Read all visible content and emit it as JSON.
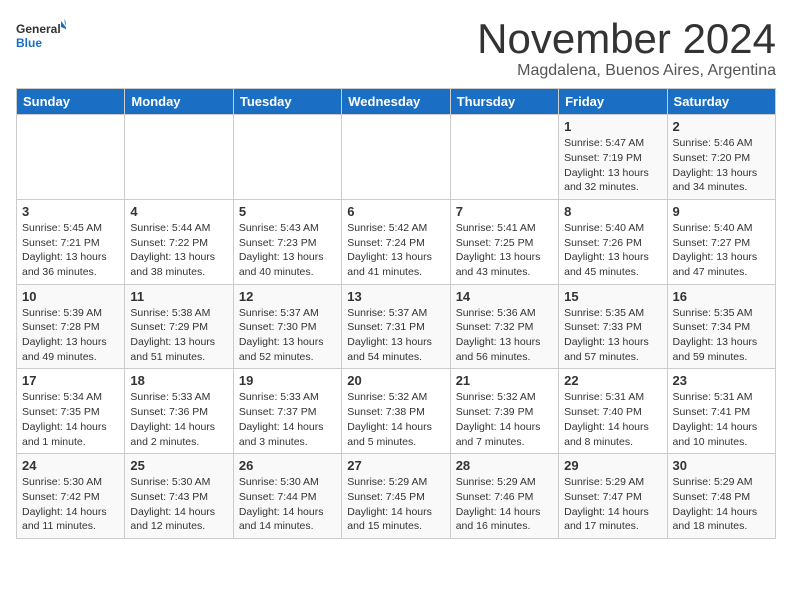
{
  "header": {
    "logo_general": "General",
    "logo_blue": "Blue",
    "month_title": "November 2024",
    "location": "Magdalena, Buenos Aires, Argentina"
  },
  "days_of_week": [
    "Sunday",
    "Monday",
    "Tuesday",
    "Wednesday",
    "Thursday",
    "Friday",
    "Saturday"
  ],
  "weeks": [
    [
      {
        "day": "",
        "info": ""
      },
      {
        "day": "",
        "info": ""
      },
      {
        "day": "",
        "info": ""
      },
      {
        "day": "",
        "info": ""
      },
      {
        "day": "",
        "info": ""
      },
      {
        "day": "1",
        "info": "Sunrise: 5:47 AM\nSunset: 7:19 PM\nDaylight: 13 hours\nand 32 minutes."
      },
      {
        "day": "2",
        "info": "Sunrise: 5:46 AM\nSunset: 7:20 PM\nDaylight: 13 hours\nand 34 minutes."
      }
    ],
    [
      {
        "day": "3",
        "info": "Sunrise: 5:45 AM\nSunset: 7:21 PM\nDaylight: 13 hours\nand 36 minutes."
      },
      {
        "day": "4",
        "info": "Sunrise: 5:44 AM\nSunset: 7:22 PM\nDaylight: 13 hours\nand 38 minutes."
      },
      {
        "day": "5",
        "info": "Sunrise: 5:43 AM\nSunset: 7:23 PM\nDaylight: 13 hours\nand 40 minutes."
      },
      {
        "day": "6",
        "info": "Sunrise: 5:42 AM\nSunset: 7:24 PM\nDaylight: 13 hours\nand 41 minutes."
      },
      {
        "day": "7",
        "info": "Sunrise: 5:41 AM\nSunset: 7:25 PM\nDaylight: 13 hours\nand 43 minutes."
      },
      {
        "day": "8",
        "info": "Sunrise: 5:40 AM\nSunset: 7:26 PM\nDaylight: 13 hours\nand 45 minutes."
      },
      {
        "day": "9",
        "info": "Sunrise: 5:40 AM\nSunset: 7:27 PM\nDaylight: 13 hours\nand 47 minutes."
      }
    ],
    [
      {
        "day": "10",
        "info": "Sunrise: 5:39 AM\nSunset: 7:28 PM\nDaylight: 13 hours\nand 49 minutes."
      },
      {
        "day": "11",
        "info": "Sunrise: 5:38 AM\nSunset: 7:29 PM\nDaylight: 13 hours\nand 51 minutes."
      },
      {
        "day": "12",
        "info": "Sunrise: 5:37 AM\nSunset: 7:30 PM\nDaylight: 13 hours\nand 52 minutes."
      },
      {
        "day": "13",
        "info": "Sunrise: 5:37 AM\nSunset: 7:31 PM\nDaylight: 13 hours\nand 54 minutes."
      },
      {
        "day": "14",
        "info": "Sunrise: 5:36 AM\nSunset: 7:32 PM\nDaylight: 13 hours\nand 56 minutes."
      },
      {
        "day": "15",
        "info": "Sunrise: 5:35 AM\nSunset: 7:33 PM\nDaylight: 13 hours\nand 57 minutes."
      },
      {
        "day": "16",
        "info": "Sunrise: 5:35 AM\nSunset: 7:34 PM\nDaylight: 13 hours\nand 59 minutes."
      }
    ],
    [
      {
        "day": "17",
        "info": "Sunrise: 5:34 AM\nSunset: 7:35 PM\nDaylight: 14 hours\nand 1 minute."
      },
      {
        "day": "18",
        "info": "Sunrise: 5:33 AM\nSunset: 7:36 PM\nDaylight: 14 hours\nand 2 minutes."
      },
      {
        "day": "19",
        "info": "Sunrise: 5:33 AM\nSunset: 7:37 PM\nDaylight: 14 hours\nand 3 minutes."
      },
      {
        "day": "20",
        "info": "Sunrise: 5:32 AM\nSunset: 7:38 PM\nDaylight: 14 hours\nand 5 minutes."
      },
      {
        "day": "21",
        "info": "Sunrise: 5:32 AM\nSunset: 7:39 PM\nDaylight: 14 hours\nand 7 minutes."
      },
      {
        "day": "22",
        "info": "Sunrise: 5:31 AM\nSunset: 7:40 PM\nDaylight: 14 hours\nand 8 minutes."
      },
      {
        "day": "23",
        "info": "Sunrise: 5:31 AM\nSunset: 7:41 PM\nDaylight: 14 hours\nand 10 minutes."
      }
    ],
    [
      {
        "day": "24",
        "info": "Sunrise: 5:30 AM\nSunset: 7:42 PM\nDaylight: 14 hours\nand 11 minutes."
      },
      {
        "day": "25",
        "info": "Sunrise: 5:30 AM\nSunset: 7:43 PM\nDaylight: 14 hours\nand 12 minutes."
      },
      {
        "day": "26",
        "info": "Sunrise: 5:30 AM\nSunset: 7:44 PM\nDaylight: 14 hours\nand 14 minutes."
      },
      {
        "day": "27",
        "info": "Sunrise: 5:29 AM\nSunset: 7:45 PM\nDaylight: 14 hours\nand 15 minutes."
      },
      {
        "day": "28",
        "info": "Sunrise: 5:29 AM\nSunset: 7:46 PM\nDaylight: 14 hours\nand 16 minutes."
      },
      {
        "day": "29",
        "info": "Sunrise: 5:29 AM\nSunset: 7:47 PM\nDaylight: 14 hours\nand 17 minutes."
      },
      {
        "day": "30",
        "info": "Sunrise: 5:29 AM\nSunset: 7:48 PM\nDaylight: 14 hours\nand 18 minutes."
      }
    ]
  ]
}
